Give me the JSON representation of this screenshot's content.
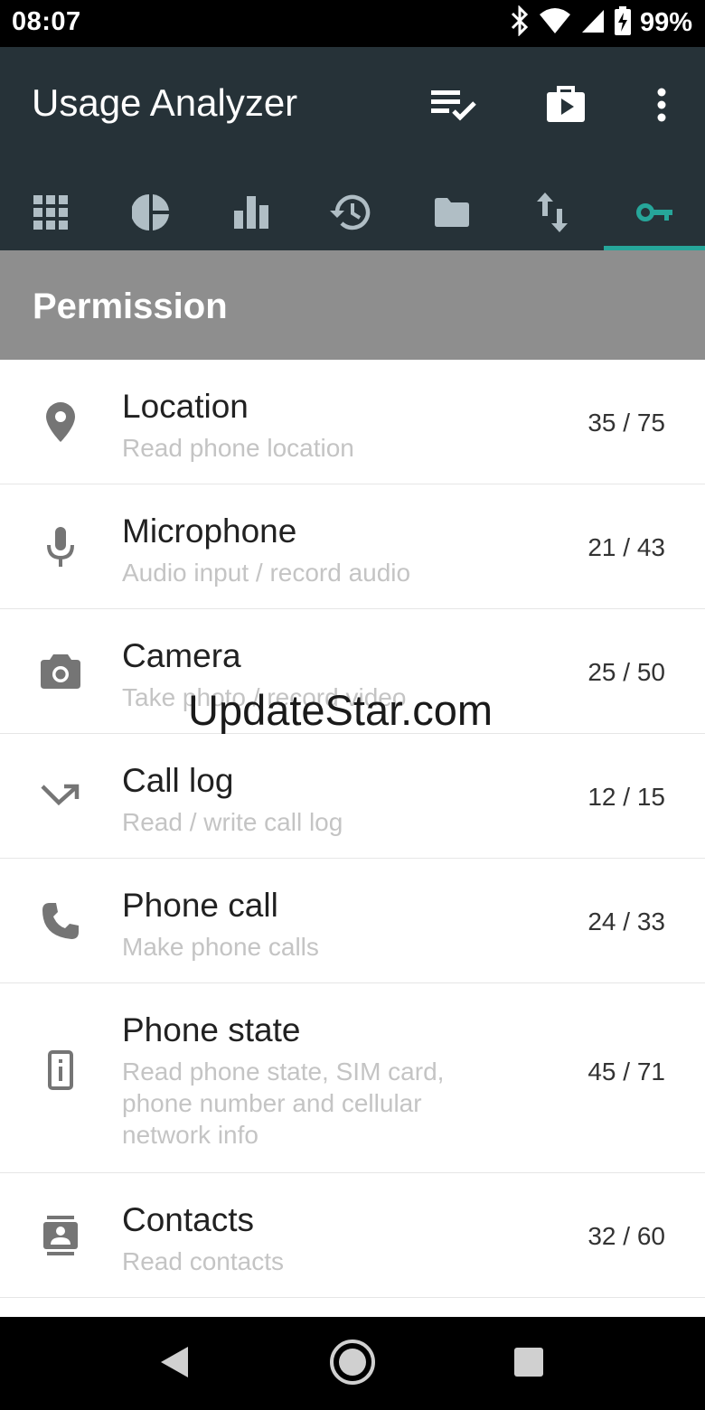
{
  "status_bar": {
    "time": "08:07",
    "battery": "99%"
  },
  "app_bar": {
    "title": "Usage Analyzer",
    "actions": [
      "playlist-check-icon",
      "play-store-icon",
      "more-vert-icon"
    ]
  },
  "tabs": [
    {
      "icon": "apps-grid-icon"
    },
    {
      "icon": "pie-chart-icon"
    },
    {
      "icon": "bar-chart-icon"
    },
    {
      "icon": "history-icon"
    },
    {
      "icon": "folder-icon"
    },
    {
      "icon": "data-transfer-icon"
    },
    {
      "icon": "key-icon",
      "selected": true
    }
  ],
  "accent_color": "#26a69a",
  "section": {
    "title": "Permission"
  },
  "permissions": [
    {
      "title": "Location",
      "subtitle": "Read phone location",
      "count": "35 / 75",
      "icon": "location-pin-icon"
    },
    {
      "title": "Microphone",
      "subtitle": "Audio input / record audio",
      "count": "21 / 43",
      "icon": "microphone-icon"
    },
    {
      "title": "Camera",
      "subtitle": "Take photo / record video",
      "count": "25 / 50",
      "icon": "camera-icon"
    },
    {
      "title": "Call log",
      "subtitle": "Read / write call log",
      "count": "12 / 15",
      "icon": "call-missed-icon"
    },
    {
      "title": "Phone call",
      "subtitle": "Make phone calls",
      "count": "24 / 33",
      "icon": "phone-icon"
    },
    {
      "title": "Phone state",
      "subtitle": "Read phone state, SIM card, phone number and cellular network info",
      "count": "45 / 71",
      "icon": "phone-info-icon"
    },
    {
      "title": "Contacts",
      "subtitle": "Read contacts",
      "count": "32 / 60",
      "icon": "contacts-icon"
    }
  ],
  "watermark": "UpdateStar.com"
}
